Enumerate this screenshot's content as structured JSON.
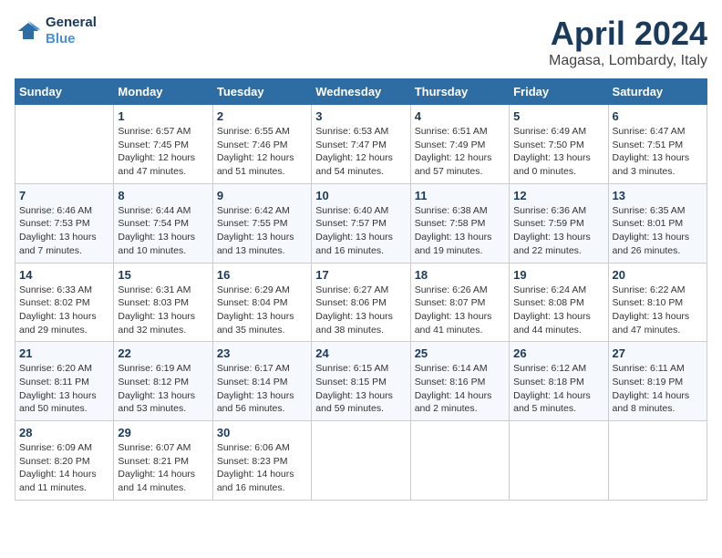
{
  "header": {
    "logo_line1": "General",
    "logo_line2": "Blue",
    "month_year": "April 2024",
    "location": "Magasa, Lombardy, Italy"
  },
  "columns": [
    "Sunday",
    "Monday",
    "Tuesday",
    "Wednesday",
    "Thursday",
    "Friday",
    "Saturday"
  ],
  "weeks": [
    [
      {
        "day": "",
        "info": ""
      },
      {
        "day": "1",
        "info": "Sunrise: 6:57 AM\nSunset: 7:45 PM\nDaylight: 12 hours\nand 47 minutes."
      },
      {
        "day": "2",
        "info": "Sunrise: 6:55 AM\nSunset: 7:46 PM\nDaylight: 12 hours\nand 51 minutes."
      },
      {
        "day": "3",
        "info": "Sunrise: 6:53 AM\nSunset: 7:47 PM\nDaylight: 12 hours\nand 54 minutes."
      },
      {
        "day": "4",
        "info": "Sunrise: 6:51 AM\nSunset: 7:49 PM\nDaylight: 12 hours\nand 57 minutes."
      },
      {
        "day": "5",
        "info": "Sunrise: 6:49 AM\nSunset: 7:50 PM\nDaylight: 13 hours\nand 0 minutes."
      },
      {
        "day": "6",
        "info": "Sunrise: 6:47 AM\nSunset: 7:51 PM\nDaylight: 13 hours\nand 3 minutes."
      }
    ],
    [
      {
        "day": "7",
        "info": "Sunrise: 6:46 AM\nSunset: 7:53 PM\nDaylight: 13 hours\nand 7 minutes."
      },
      {
        "day": "8",
        "info": "Sunrise: 6:44 AM\nSunset: 7:54 PM\nDaylight: 13 hours\nand 10 minutes."
      },
      {
        "day": "9",
        "info": "Sunrise: 6:42 AM\nSunset: 7:55 PM\nDaylight: 13 hours\nand 13 minutes."
      },
      {
        "day": "10",
        "info": "Sunrise: 6:40 AM\nSunset: 7:57 PM\nDaylight: 13 hours\nand 16 minutes."
      },
      {
        "day": "11",
        "info": "Sunrise: 6:38 AM\nSunset: 7:58 PM\nDaylight: 13 hours\nand 19 minutes."
      },
      {
        "day": "12",
        "info": "Sunrise: 6:36 AM\nSunset: 7:59 PM\nDaylight: 13 hours\nand 22 minutes."
      },
      {
        "day": "13",
        "info": "Sunrise: 6:35 AM\nSunset: 8:01 PM\nDaylight: 13 hours\nand 26 minutes."
      }
    ],
    [
      {
        "day": "14",
        "info": "Sunrise: 6:33 AM\nSunset: 8:02 PM\nDaylight: 13 hours\nand 29 minutes."
      },
      {
        "day": "15",
        "info": "Sunrise: 6:31 AM\nSunset: 8:03 PM\nDaylight: 13 hours\nand 32 minutes."
      },
      {
        "day": "16",
        "info": "Sunrise: 6:29 AM\nSunset: 8:04 PM\nDaylight: 13 hours\nand 35 minutes."
      },
      {
        "day": "17",
        "info": "Sunrise: 6:27 AM\nSunset: 8:06 PM\nDaylight: 13 hours\nand 38 minutes."
      },
      {
        "day": "18",
        "info": "Sunrise: 6:26 AM\nSunset: 8:07 PM\nDaylight: 13 hours\nand 41 minutes."
      },
      {
        "day": "19",
        "info": "Sunrise: 6:24 AM\nSunset: 8:08 PM\nDaylight: 13 hours\nand 44 minutes."
      },
      {
        "day": "20",
        "info": "Sunrise: 6:22 AM\nSunset: 8:10 PM\nDaylight: 13 hours\nand 47 minutes."
      }
    ],
    [
      {
        "day": "21",
        "info": "Sunrise: 6:20 AM\nSunset: 8:11 PM\nDaylight: 13 hours\nand 50 minutes."
      },
      {
        "day": "22",
        "info": "Sunrise: 6:19 AM\nSunset: 8:12 PM\nDaylight: 13 hours\nand 53 minutes."
      },
      {
        "day": "23",
        "info": "Sunrise: 6:17 AM\nSunset: 8:14 PM\nDaylight: 13 hours\nand 56 minutes."
      },
      {
        "day": "24",
        "info": "Sunrise: 6:15 AM\nSunset: 8:15 PM\nDaylight: 13 hours\nand 59 minutes."
      },
      {
        "day": "25",
        "info": "Sunrise: 6:14 AM\nSunset: 8:16 PM\nDaylight: 14 hours\nand 2 minutes."
      },
      {
        "day": "26",
        "info": "Sunrise: 6:12 AM\nSunset: 8:18 PM\nDaylight: 14 hours\nand 5 minutes."
      },
      {
        "day": "27",
        "info": "Sunrise: 6:11 AM\nSunset: 8:19 PM\nDaylight: 14 hours\nand 8 minutes."
      }
    ],
    [
      {
        "day": "28",
        "info": "Sunrise: 6:09 AM\nSunset: 8:20 PM\nDaylight: 14 hours\nand 11 minutes."
      },
      {
        "day": "29",
        "info": "Sunrise: 6:07 AM\nSunset: 8:21 PM\nDaylight: 14 hours\nand 14 minutes."
      },
      {
        "day": "30",
        "info": "Sunrise: 6:06 AM\nSunset: 8:23 PM\nDaylight: 14 hours\nand 16 minutes."
      },
      {
        "day": "",
        "info": ""
      },
      {
        "day": "",
        "info": ""
      },
      {
        "day": "",
        "info": ""
      },
      {
        "day": "",
        "info": ""
      }
    ]
  ]
}
